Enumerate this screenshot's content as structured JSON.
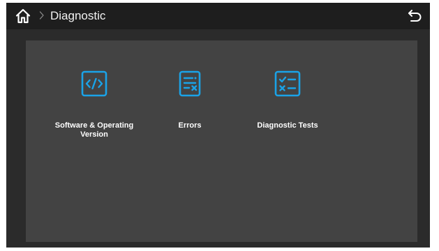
{
  "header": {
    "title": "Diagnostic",
    "home_icon": "home-icon",
    "separator_icon": "chevron-right-icon",
    "back_icon": "back-icon"
  },
  "tiles": [
    {
      "label": "Software & Operating Version",
      "icon": "code-icon"
    },
    {
      "label": "Errors",
      "icon": "error-list-icon"
    },
    {
      "label": "Diagnostic Tests",
      "icon": "checklist-icon"
    }
  ],
  "colors": {
    "header_bg": "#1e1e1e",
    "screen_bg": "#2b2b2b",
    "panel_bg": "#434343",
    "accent": "#1aa3e8",
    "text": "#ffffff"
  }
}
